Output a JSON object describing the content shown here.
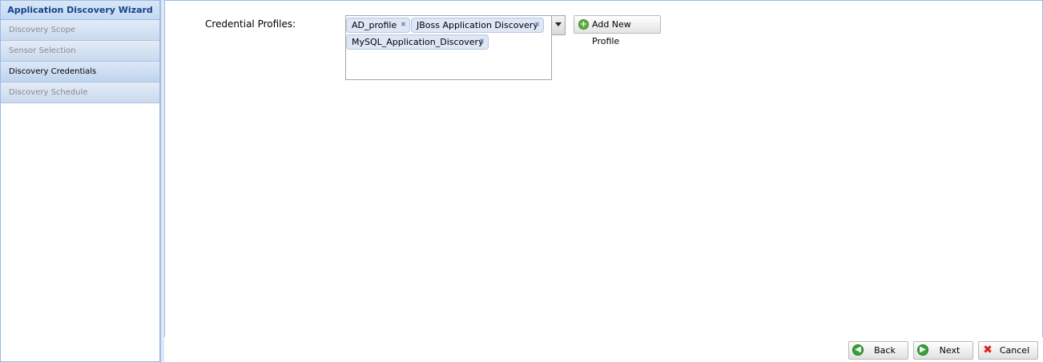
{
  "sidebar": {
    "title": "Application Discovery Wizard",
    "steps": [
      {
        "label": "Discovery Scope",
        "active": false
      },
      {
        "label": "Sensor Selection",
        "active": false
      },
      {
        "label": "Discovery Credentials",
        "active": true
      },
      {
        "label": "Discovery Schedule",
        "active": false
      }
    ]
  },
  "form": {
    "credential_label": "Credential Profiles:",
    "selected_profiles": [
      "AD_profile",
      "JBoss Application Discovery",
      "MySQL_Application_Discovery"
    ],
    "add_profile_label": "Add New Profile"
  },
  "footer": {
    "back_label": "Back",
    "next_label": "Next",
    "cancel_label": "Cancel"
  },
  "icons": {
    "tag_remove": "close-icon",
    "dropdown": "chevron-down-icon",
    "add": "plus-circle-icon",
    "back": "arrow-left-icon",
    "next": "arrow-right-icon",
    "cancel": "red-x-icon"
  },
  "colors": {
    "panel_border": "#99bbe8",
    "title_text": "#15428b",
    "tag_bg": "#dee7f5",
    "add_icon": "#5bb03c",
    "nav_icon": "#3aa23a",
    "cancel_icon": "#d92222"
  }
}
